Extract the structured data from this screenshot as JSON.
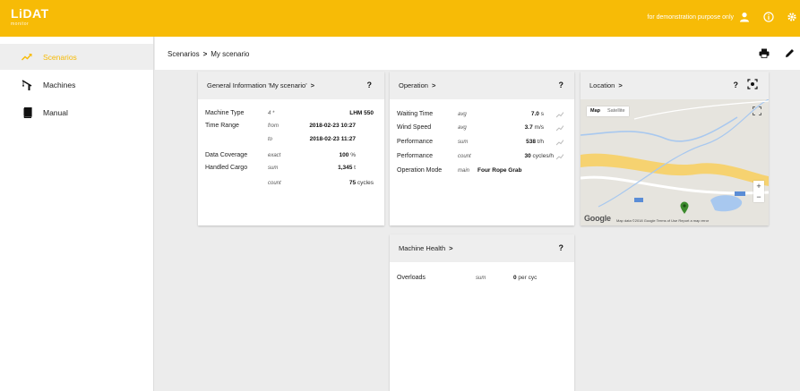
{
  "app": {
    "logo": "LiDAT",
    "logo_sub": "monitor",
    "demo_notice": "for demonstration purpose only"
  },
  "colors": {
    "accent": "#f7bb06",
    "card_header": "#eeeeee",
    "map_water": "#a8c8ef",
    "map_road": "#f6d270",
    "pin": "#3b8a2c"
  },
  "sidebar": {
    "items": [
      {
        "label": "Scenarios",
        "icon": "trend-icon",
        "active": true
      },
      {
        "label": "Machines",
        "icon": "crane-icon",
        "active": false
      },
      {
        "label": "Manual",
        "icon": "book-icon",
        "active": false
      }
    ]
  },
  "breadcrumb": {
    "root": "Scenarios",
    "sep": ">",
    "current": "My scenario"
  },
  "general": {
    "title": "General Information 'My scenario'",
    "chev": ">",
    "help": "?",
    "rows": [
      {
        "k": "Machine Type",
        "q": "4 *",
        "v": "LHM 550",
        "u": ""
      },
      {
        "k": "Time Range",
        "q": "from",
        "v": "2018-02-23 10:27",
        "u": ""
      },
      {
        "k": "",
        "q": "to",
        "v": "2018-02-23 11:27",
        "u": ""
      },
      {
        "k": "Data Coverage",
        "q": "exact",
        "v": "100",
        "u": " %"
      },
      {
        "k": "Handled Cargo",
        "q": "sum",
        "v": "1,345",
        "u": " t"
      },
      {
        "k": "",
        "q": "count",
        "v": "75",
        "u": " cycles"
      }
    ]
  },
  "operation": {
    "title": "Operation",
    "chev": ">",
    "help": "?",
    "rows": [
      {
        "k": "Waiting Time",
        "q": "avg",
        "v": "7.0",
        "u": " s"
      },
      {
        "k": "Wind Speed",
        "q": "avg",
        "v": "3.7",
        "u": " m/s"
      },
      {
        "k": "Performance",
        "q": "sum",
        "v": "538",
        "u": " t/h"
      },
      {
        "k": "Performance",
        "q": "count",
        "v": "30",
        "u": " cycles/h"
      },
      {
        "k": "Operation Mode",
        "q": "main",
        "v": "Four Rope Grab",
        "u": ""
      }
    ]
  },
  "location": {
    "title": "Location",
    "chev": ">",
    "help": "?",
    "map_tab_map": "Map",
    "map_tab_satellite": "Satellite",
    "zoom_in": "+",
    "zoom_out": "−",
    "google": "Google",
    "footer": "Map data ©2018 Google    Terms of Use    Report a map error"
  },
  "health": {
    "title": "Machine Health",
    "chev": ">",
    "help": "?",
    "rows": [
      {
        "k": "Overloads",
        "q": "sum",
        "v": "0",
        "u": " per cyc"
      }
    ]
  }
}
